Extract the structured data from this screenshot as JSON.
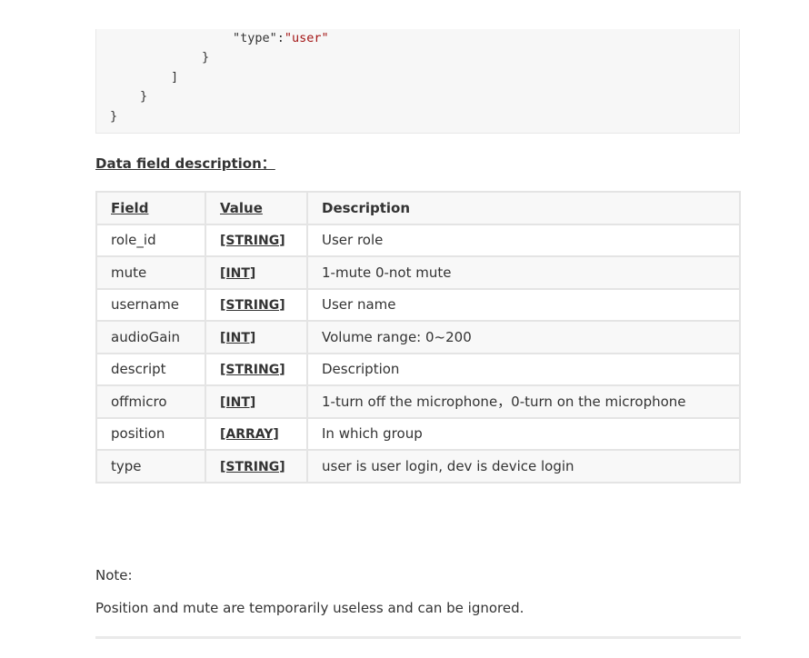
{
  "code": {
    "line1_key": "\"type\":",
    "line1_value": "\"user\"",
    "line2": "}",
    "line3": "]",
    "line4": "}",
    "line5": "}"
  },
  "section_title": "Data field description：",
  "table": {
    "headers": {
      "field": "Field",
      "value": "Value",
      "description": "Description"
    },
    "rows": [
      {
        "field": "role_id",
        "value": "[STRING]",
        "description": "User role"
      },
      {
        "field": "mute",
        "value": "[INT]",
        "description": "1-mute 0-not mute"
      },
      {
        "field": "username",
        "value": "[STRING]",
        "description": "User name"
      },
      {
        "field": "audioGain",
        "value": "[INT]",
        "description": "Volume range: 0~200"
      },
      {
        "field": "descript",
        "value": "[STRING]",
        "description": "Description"
      },
      {
        "field": "offmicro",
        "value": "[INT]",
        "description": "1-turn off the microphone，0-turn on the microphone"
      },
      {
        "field": "position",
        "value": "[ARRAY]",
        "description": "In which group"
      },
      {
        "field": "type",
        "value": "[STRING]",
        "description": "user is user login, dev is device login"
      }
    ]
  },
  "note": {
    "label": "Note:",
    "text": "Position and mute are temporarily useless and can be ignored."
  }
}
